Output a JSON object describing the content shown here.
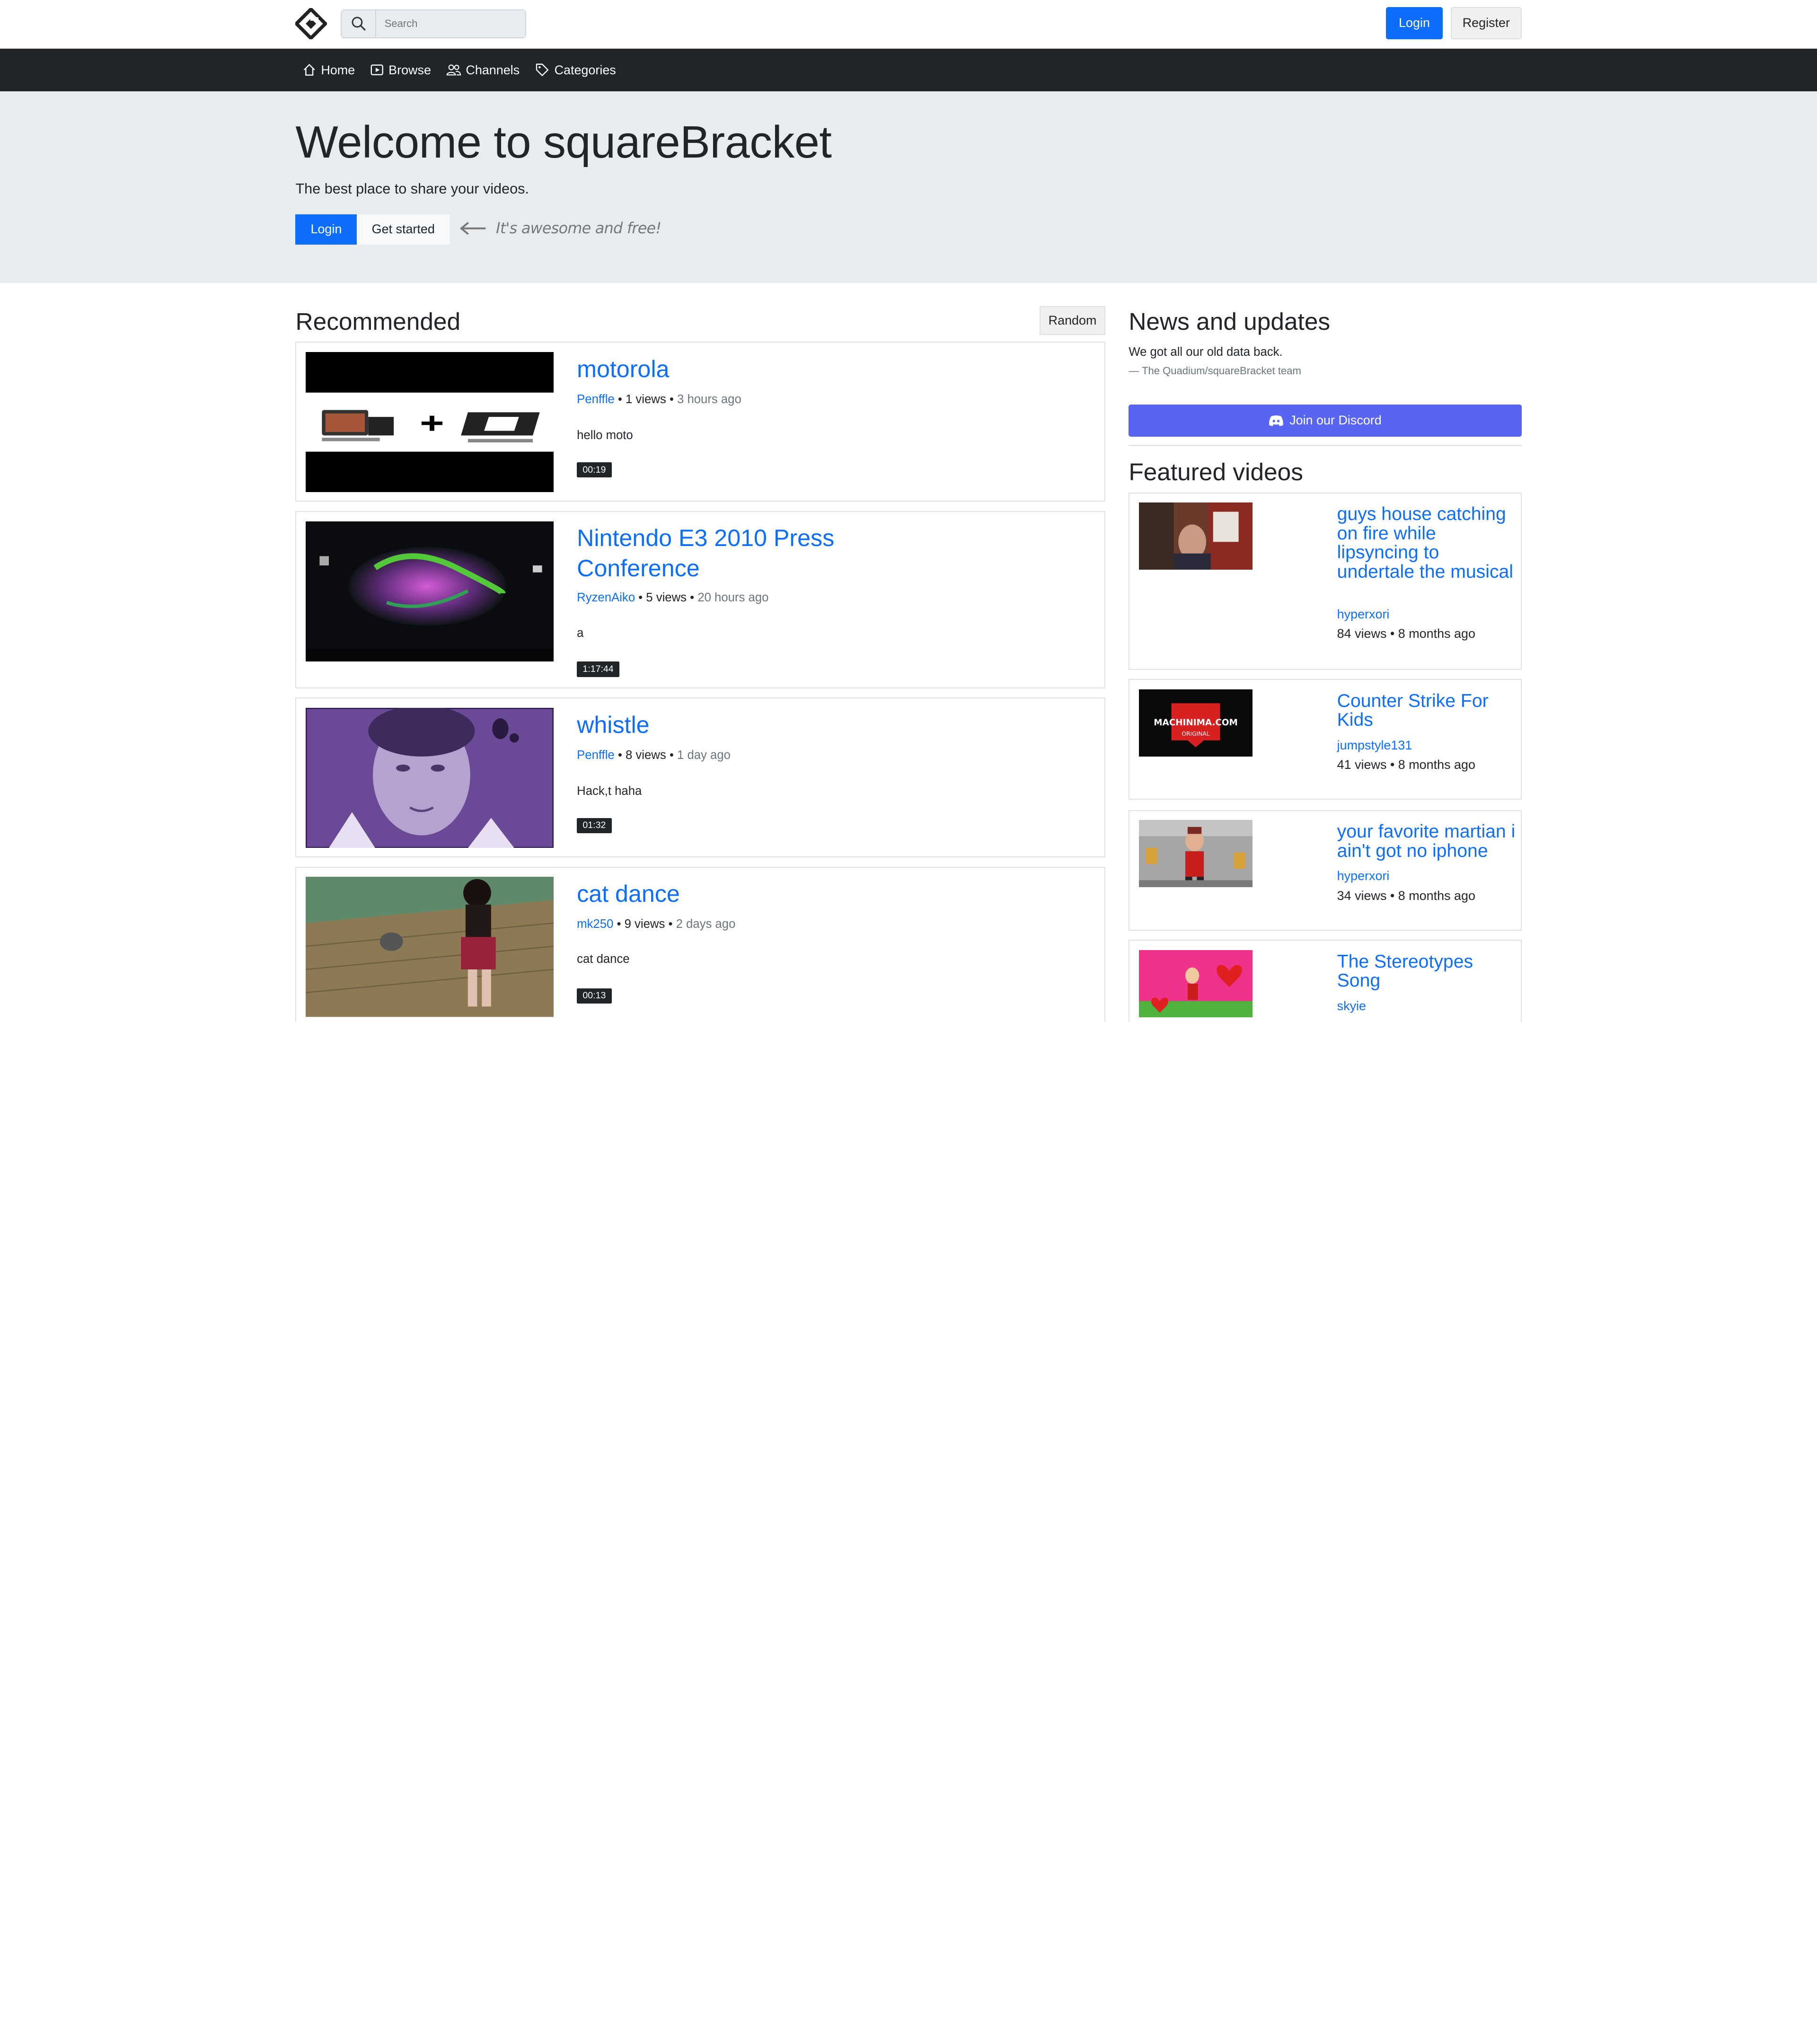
{
  "header": {
    "search_placeholder": "Search",
    "login_label": "Login",
    "register_label": "Register"
  },
  "nav": {
    "items": [
      {
        "label": "Home",
        "icon": "home-icon"
      },
      {
        "label": "Browse",
        "icon": "play-square-icon"
      },
      {
        "label": "Channels",
        "icon": "people-icon"
      },
      {
        "label": "Categories",
        "icon": "tag-icon"
      }
    ]
  },
  "hero": {
    "title": "Welcome to squareBracket",
    "subtitle": "The best place to share your videos.",
    "login_label": "Login",
    "get_started_label": "Get started",
    "note": "It's awesome and free!"
  },
  "recommended": {
    "title": "Recommended",
    "random_label": "Random",
    "videos": [
      {
        "title": "motorola",
        "author": "Penffle",
        "views": "1 views",
        "time": "3 hours ago",
        "description": "hello moto",
        "duration": "00:19"
      },
      {
        "title": "Nintendo E3 2010 Press Conference",
        "author": "RyzenAiko",
        "views": "5 views",
        "time": "20 hours ago",
        "description": "a",
        "duration": "1:17:44"
      },
      {
        "title": "whistle",
        "author": "Penffle",
        "views": "8 views",
        "time": "1 day ago",
        "description": "Hack,t haha",
        "duration": "01:32"
      },
      {
        "title": "cat dance",
        "author": "mk250",
        "views": "9 views",
        "time": "2 days ago",
        "description": "cat dance",
        "duration": "00:13"
      }
    ]
  },
  "news": {
    "title": "News and updates",
    "text": "We got all our old data back.",
    "signature": "— The Quadium/squareBracket team",
    "discord_label": "Join our Discord"
  },
  "featured": {
    "title": "Featured videos",
    "videos": [
      {
        "title": "guys house catching on fire while lipsyncing to undertale the musical",
        "author": "hyperxori",
        "meta": "84 views • 8 months ago"
      },
      {
        "title": "Counter Strike For Kids",
        "author": "jumpstyle131",
        "meta": "41 views • 8 months ago"
      },
      {
        "title": "your favorite martian i ain't got no iphone",
        "author": "hyperxori",
        "meta": "34 views • 8 months ago"
      },
      {
        "title": "The Stereotypes Song",
        "author": "skyie",
        "meta": ""
      }
    ]
  },
  "colors": {
    "accent": "#0d6efd",
    "navbar": "#212529",
    "hero_bg": "#e9ecef",
    "discord": "#5865f2"
  }
}
